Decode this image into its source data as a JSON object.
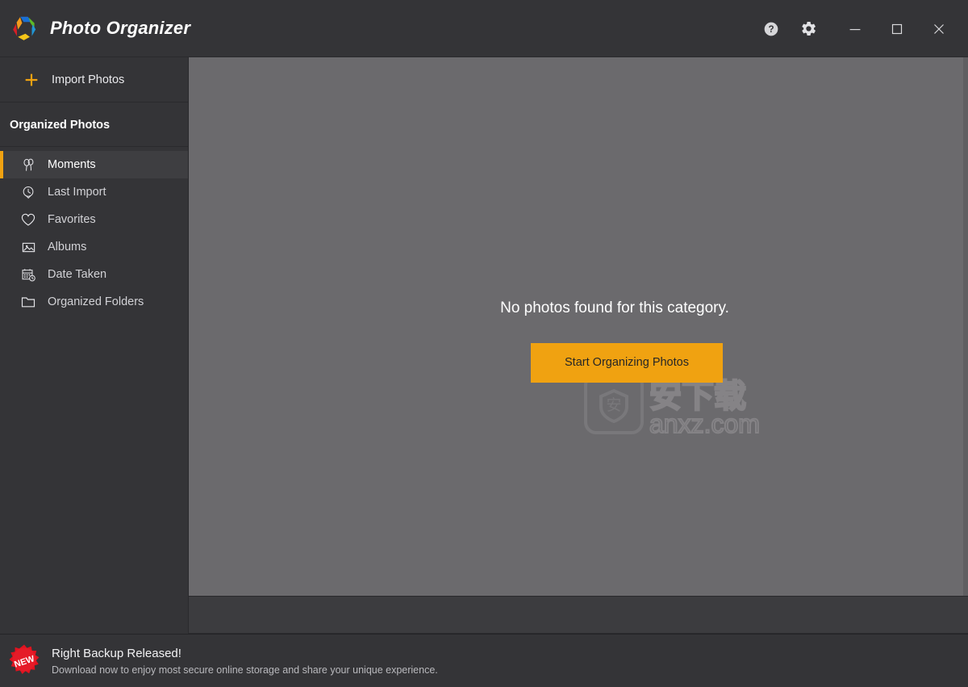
{
  "window": {
    "app_title": "Photo Organizer",
    "logo_icon": "hex-pinwheel-logo",
    "controls": [
      {
        "name": "help-button",
        "icon": "help-circle-icon",
        "label": "?"
      },
      {
        "name": "settings-button",
        "icon": "gear-icon",
        "label": "Settings"
      },
      {
        "name": "minimize-button",
        "icon": "minimize-icon",
        "label": "Minimize"
      },
      {
        "name": "maximize-button",
        "icon": "maximize-icon",
        "label": "Maximize"
      },
      {
        "name": "close-button",
        "icon": "close-icon",
        "label": "Close"
      }
    ]
  },
  "sidebar": {
    "import": {
      "label": "Import Photos",
      "icon": "plus-icon"
    },
    "section_title": "Organized Photos",
    "items": [
      {
        "label": "Moments",
        "icon": "balloons-icon",
        "selected": true
      },
      {
        "label": "Last Import",
        "icon": "clock-import-icon",
        "selected": false
      },
      {
        "label": "Favorites",
        "icon": "heart-icon",
        "selected": false
      },
      {
        "label": "Albums",
        "icon": "image-icon",
        "selected": false
      },
      {
        "label": "Date Taken",
        "icon": "calendar-clock-icon",
        "selected": false
      },
      {
        "label": "Organized Folders",
        "icon": "folder-icon",
        "selected": false
      }
    ]
  },
  "content": {
    "empty_message": "No photos found for this category.",
    "cta_label": "Start Organizing Photos",
    "watermark": {
      "logo_char": "安",
      "brand_text": "安下载",
      "site": "anxz.com"
    }
  },
  "promo": {
    "badge_text": "NEW",
    "title": "Right Backup Released!",
    "subtitle": "Download now to enjoy most secure online storage and share your unique experience."
  },
  "colors": {
    "accent": "#f0a211",
    "chrome": "#343437",
    "content": "#6b6a6d",
    "selected_row": "#3e3e41",
    "badge_red": "#e0131f"
  }
}
